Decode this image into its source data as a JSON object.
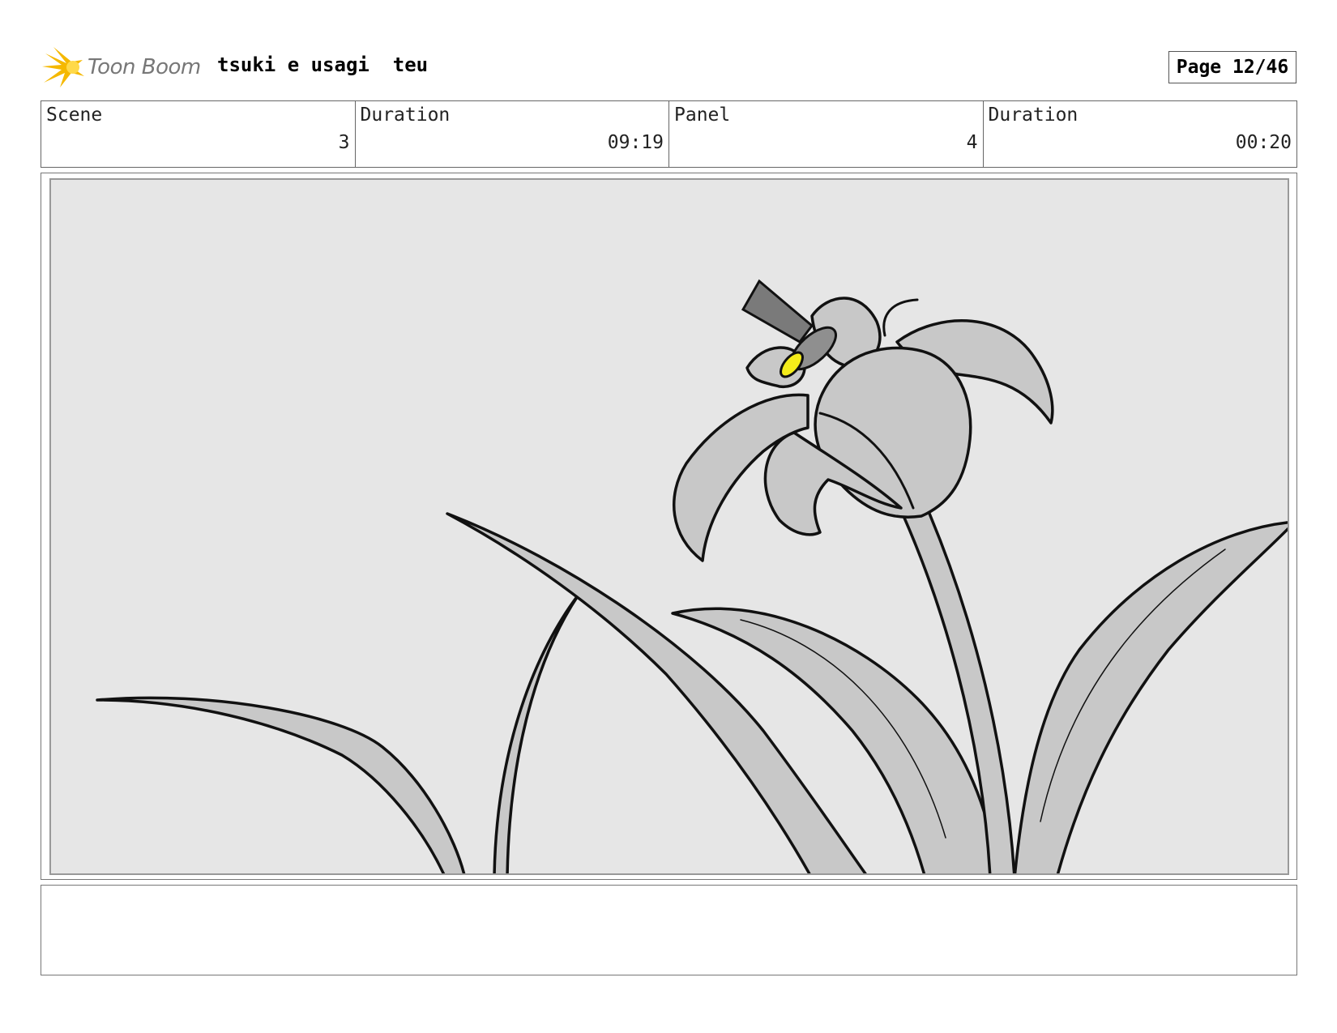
{
  "header": {
    "logo_text": "Toon Boom",
    "project_title": "tsuki e usagi  teu",
    "page_label": "Page 12/46"
  },
  "info": {
    "scene_label": "Scene",
    "scene_value": "3",
    "scene_duration_label": "Duration",
    "scene_duration_value": "09:19",
    "panel_label": "Panel",
    "panel_value": "4",
    "panel_duration_label": "Duration",
    "panel_duration_value": "00:20"
  },
  "notes": {
    "text": ""
  },
  "colors": {
    "panel_background": "#e6e6e6",
    "leaf_fill": "#c8c8c8",
    "accent_yellow": "#f4ec1a",
    "logo_orange": "#f5b800"
  }
}
